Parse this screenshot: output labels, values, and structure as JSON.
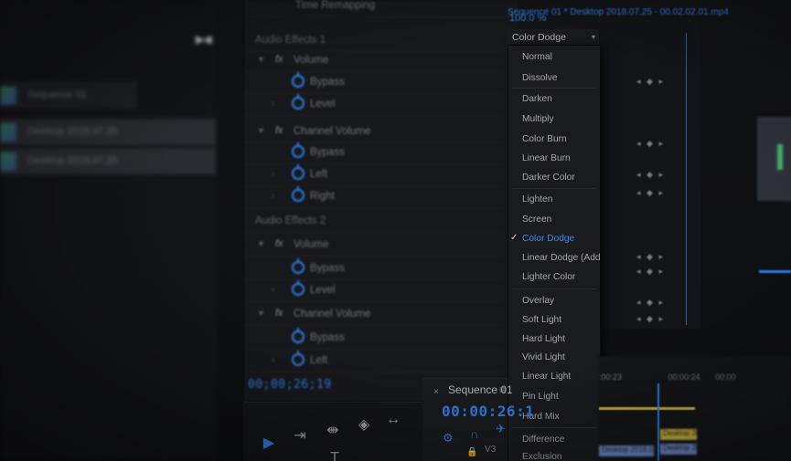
{
  "left_panel": {
    "bins": [
      {
        "name": "Sequence 01",
        "selected": false
      },
      {
        "name": "Desktop 2018.07.25",
        "selected": true
      },
      {
        "name": "Desktop 2018.07.25",
        "selected": true
      }
    ]
  },
  "effect_controls": {
    "top_row": "Time Remapping",
    "rows": [
      {
        "label": "Audio Effects 1",
        "kind": "section"
      },
      {
        "label": "Volume",
        "kind": "effect"
      },
      {
        "label": "Bypass",
        "kind": "param"
      },
      {
        "label": "Level",
        "kind": "param"
      },
      {
        "label": "Channel Volume",
        "kind": "effect"
      },
      {
        "label": "Bypass",
        "kind": "param"
      },
      {
        "label": "Left",
        "kind": "param"
      },
      {
        "label": "Right",
        "kind": "param"
      },
      {
        "label": "Audio Effects 2",
        "kind": "section"
      },
      {
        "label": "Volume",
        "kind": "effect"
      },
      {
        "label": "Bypass",
        "kind": "param"
      },
      {
        "label": "Level",
        "kind": "param"
      },
      {
        "label": "Channel Volume",
        "kind": "effect"
      },
      {
        "label": "Bypass",
        "kind": "param"
      },
      {
        "label": "Left",
        "kind": "param"
      }
    ],
    "timecode": "00;00;26;19",
    "fx_badge": "fx"
  },
  "header": {
    "clip_path": "Sequence 01 * Desktop 2018.07.25 - 00.02.02.01.mp4",
    "opacity": "100.0 %"
  },
  "blend_mode": {
    "selected": "Color Dodge",
    "groups": [
      [
        "Normal",
        "Dissolve"
      ],
      [
        "Darken",
        "Multiply",
        "Color Burn",
        "Linear Burn",
        "Darker Color"
      ],
      [
        "Lighten",
        "Screen",
        "Color Dodge",
        "Linear Dodge (Add)",
        "Lighter Color"
      ],
      [
        "Overlay",
        "Soft Light",
        "Hard Light",
        "Vivid Light",
        "Linear Light",
        "Pin Light",
        "Hard Mix"
      ],
      [
        "Difference",
        "Exclusion"
      ]
    ]
  },
  "sequence_monitor": {
    "tab_label": "Sequence 01",
    "timecode": "00:00:26:1",
    "track_label": "V3"
  },
  "timeline": {
    "ruler": ":00:23",
    "ruler_right": "00:00:24",
    "ruler_far": "00:00",
    "clip_label": "Desktop 2018.07.25"
  },
  "colors": {
    "accent": "#2f7fe8",
    "panel": "#17181b",
    "background": "#0e0f11",
    "work_area": "#c9b43a"
  },
  "icons": {
    "selection_tool": "selection-arrow-icon",
    "track_select": "track-select-forward-icon",
    "ripple_edit": "ripple-edit-icon",
    "razor": "razor-icon",
    "slip": "slip-icon",
    "type": "type-tool-icon"
  }
}
